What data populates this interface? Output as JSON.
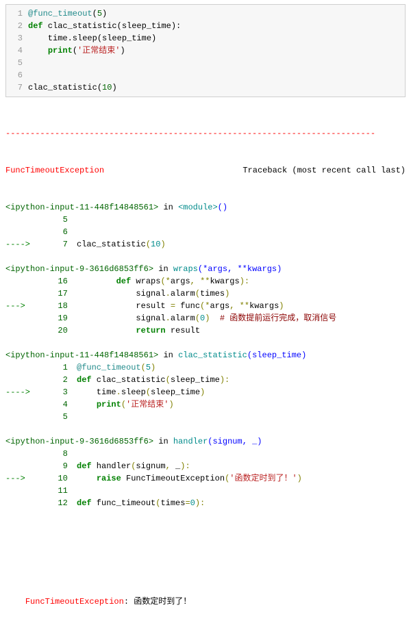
{
  "code_input": {
    "lines": [
      {
        "n": "1",
        "segs": [
          {
            "t": "@func_timeout",
            "c": "k-teal"
          },
          {
            "t": "(",
            "c": ""
          },
          {
            "t": "5",
            "c": "k-dkgreen"
          },
          {
            "t": ")",
            "c": ""
          }
        ]
      },
      {
        "n": "2",
        "segs": [
          {
            "t": "def",
            "c": "k-green"
          },
          {
            "t": " clac_statistic(sleep_time):",
            "c": ""
          }
        ]
      },
      {
        "n": "3",
        "segs": [
          {
            "t": "    time.sleep(sleep_time)",
            "c": ""
          }
        ]
      },
      {
        "n": "4",
        "segs": [
          {
            "t": "    ",
            "c": ""
          },
          {
            "t": "print",
            "c": "k-green"
          },
          {
            "t": "(",
            "c": ""
          },
          {
            "t": "'正常结束'",
            "c": "k-red"
          },
          {
            "t": ")",
            "c": ""
          }
        ]
      },
      {
        "n": "5",
        "segs": [
          {
            "t": "",
            "c": ""
          }
        ]
      },
      {
        "n": "6",
        "segs": [
          {
            "t": "",
            "c": ""
          }
        ]
      },
      {
        "n": "7",
        "segs": [
          {
            "t": "clac_statistic(",
            "c": ""
          },
          {
            "t": "10",
            "c": "k-dkgreen"
          },
          {
            "t": ")",
            "c": ""
          }
        ]
      }
    ]
  },
  "dashes": "---------------------------------------------------------------------------",
  "exc_name": "FuncTimeoutException",
  "traceback_label": "Traceback (most recent call last)",
  "frames": [
    {
      "loc_pre": "<ipython-input-11-448f14848561>",
      "loc_in": " in ",
      "loc_fn": "<module>",
      "loc_args": "()",
      "lines": [
        {
          "arrow": "      ",
          "n": "5",
          "segs": []
        },
        {
          "arrow": "      ",
          "n": "6",
          "segs": []
        },
        {
          "arrow": "----> ",
          "n": "7",
          "segs": [
            {
              "t": "clac_statistic",
              "c": ""
            },
            {
              "t": "(",
              "c": "k-olive"
            },
            {
              "t": "10",
              "c": "k-cyan"
            },
            {
              "t": ")",
              "c": "k-olive"
            }
          ]
        }
      ]
    },
    {
      "loc_pre": "<ipython-input-9-3616d6853ff6>",
      "loc_in": " in ",
      "loc_fn": "wraps",
      "loc_args": "(*args, **kwargs)",
      "lines": [
        {
          "arrow": "     ",
          "n": "16",
          "segs": [
            {
              "t": "        ",
              "c": ""
            },
            {
              "t": "def",
              "c": "k-green"
            },
            {
              "t": " wraps",
              "c": ""
            },
            {
              "t": "(",
              "c": "k-olive"
            },
            {
              "t": "*",
              "c": "k-olive"
            },
            {
              "t": "args",
              "c": ""
            },
            {
              "t": ",",
              "c": "k-olive"
            },
            {
              "t": " ",
              "c": ""
            },
            {
              "t": "**",
              "c": "k-olive"
            },
            {
              "t": "kwargs",
              "c": ""
            },
            {
              "t": "):",
              "c": "k-olive"
            }
          ]
        },
        {
          "arrow": "     ",
          "n": "17",
          "segs": [
            {
              "t": "            signal",
              "c": ""
            },
            {
              "t": ".",
              "c": "k-olive"
            },
            {
              "t": "alarm",
              "c": ""
            },
            {
              "t": "(",
              "c": "k-olive"
            },
            {
              "t": "times",
              "c": ""
            },
            {
              "t": ")",
              "c": "k-olive"
            }
          ]
        },
        {
          "arrow": "---> ",
          "n": "18",
          "segs": [
            {
              "t": "            result ",
              "c": ""
            },
            {
              "t": "=",
              "c": "k-olive"
            },
            {
              "t": " func",
              "c": ""
            },
            {
              "t": "(",
              "c": "k-olive"
            },
            {
              "t": "*",
              "c": "k-olive"
            },
            {
              "t": "args",
              "c": ""
            },
            {
              "t": ",",
              "c": "k-olive"
            },
            {
              "t": " ",
              "c": ""
            },
            {
              "t": "**",
              "c": "k-olive"
            },
            {
              "t": "kwargs",
              "c": ""
            },
            {
              "t": ")",
              "c": "k-olive"
            }
          ]
        },
        {
          "arrow": "     ",
          "n": "19",
          "segs": [
            {
              "t": "            signal",
              "c": ""
            },
            {
              "t": ".",
              "c": "k-olive"
            },
            {
              "t": "alarm",
              "c": ""
            },
            {
              "t": "(",
              "c": "k-olive"
            },
            {
              "t": "0",
              "c": "k-cyan"
            },
            {
              "t": ")",
              "c": "k-olive"
            },
            {
              "t": "  ",
              "c": ""
            },
            {
              "t": "# 函数提前运行完成，取消信号",
              "c": "k-darkred"
            }
          ]
        },
        {
          "arrow": "     ",
          "n": "20",
          "segs": [
            {
              "t": "            ",
              "c": ""
            },
            {
              "t": "return",
              "c": "k-green"
            },
            {
              "t": " result",
              "c": ""
            }
          ]
        }
      ]
    },
    {
      "loc_pre": "<ipython-input-11-448f14848561>",
      "loc_in": " in ",
      "loc_fn": "clac_statistic",
      "loc_args": "(sleep_time)",
      "lines": [
        {
          "arrow": "      ",
          "n": "1",
          "segs": [
            {
              "t": "@func_timeout",
              "c": "k-teal"
            },
            {
              "t": "(",
              "c": "k-olive"
            },
            {
              "t": "5",
              "c": "k-cyan"
            },
            {
              "t": ")",
              "c": "k-olive"
            }
          ]
        },
        {
          "arrow": "      ",
          "n": "2",
          "segs": [
            {
              "t": "def",
              "c": "k-green"
            },
            {
              "t": " clac_statistic",
              "c": ""
            },
            {
              "t": "(",
              "c": "k-olive"
            },
            {
              "t": "sleep_time",
              "c": ""
            },
            {
              "t": "):",
              "c": "k-olive"
            }
          ]
        },
        {
          "arrow": "----> ",
          "n": "3",
          "segs": [
            {
              "t": "    time",
              "c": ""
            },
            {
              "t": ".",
              "c": "k-olive"
            },
            {
              "t": "sleep",
              "c": ""
            },
            {
              "t": "(",
              "c": "k-olive"
            },
            {
              "t": "sleep_time",
              "c": ""
            },
            {
              "t": ")",
              "c": "k-olive"
            }
          ]
        },
        {
          "arrow": "      ",
          "n": "4",
          "segs": [
            {
              "t": "    ",
              "c": ""
            },
            {
              "t": "print",
              "c": "k-green"
            },
            {
              "t": "(",
              "c": "k-olive"
            },
            {
              "t": "'正常结束'",
              "c": "k-red"
            },
            {
              "t": ")",
              "c": "k-olive"
            }
          ]
        },
        {
          "arrow": "      ",
          "n": "5",
          "segs": []
        }
      ]
    },
    {
      "loc_pre": "<ipython-input-9-3616d6853ff6>",
      "loc_in": " in ",
      "loc_fn": "handler",
      "loc_args": "(signum, _)",
      "lines": [
        {
          "arrow": "      ",
          "n": "8",
          "segs": []
        },
        {
          "arrow": "      ",
          "n": "9",
          "segs": [
            {
              "t": "def",
              "c": "k-green"
            },
            {
              "t": " handler",
              "c": ""
            },
            {
              "t": "(",
              "c": "k-olive"
            },
            {
              "t": "signum",
              "c": ""
            },
            {
              "t": ",",
              "c": "k-olive"
            },
            {
              "t": " _",
              "c": ""
            },
            {
              "t": "):",
              "c": "k-olive"
            }
          ]
        },
        {
          "arrow": "---> ",
          "n": "10",
          "segs": [
            {
              "t": "    ",
              "c": ""
            },
            {
              "t": "raise",
              "c": "k-green"
            },
            {
              "t": " FuncTimeoutException",
              "c": ""
            },
            {
              "t": "(",
              "c": "k-olive"
            },
            {
              "t": "'函数定时到了！'",
              "c": "k-red"
            },
            {
              "t": ")",
              "c": "k-olive"
            }
          ]
        },
        {
          "arrow": "     ",
          "n": "11",
          "segs": []
        },
        {
          "arrow": "     ",
          "n": "12",
          "segs": [
            {
              "t": "def",
              "c": "k-green"
            },
            {
              "t": " func_timeout",
              "c": ""
            },
            {
              "t": "(",
              "c": "k-olive"
            },
            {
              "t": "times",
              "c": ""
            },
            {
              "t": "=",
              "c": "k-olive"
            },
            {
              "t": "0",
              "c": "k-cyan"
            },
            {
              "t": "):",
              "c": "k-olive"
            }
          ]
        }
      ]
    }
  ],
  "final_error": {
    "name": "FuncTimeoutException",
    "sep": ": ",
    "msg": "函数定时到了！"
  }
}
